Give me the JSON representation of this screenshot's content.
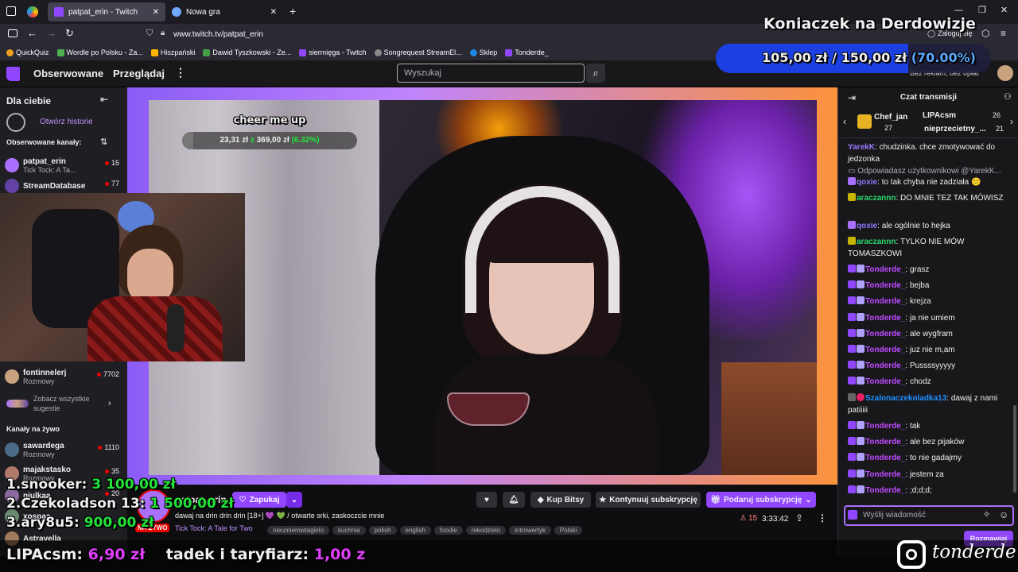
{
  "browser": {
    "tabs": [
      {
        "title": "patpat_erin - Twitch"
      },
      {
        "title": "Nowa gra"
      }
    ],
    "url": "www.twitch.tv/patpat_erin",
    "login_label": "Zaloguj się",
    "bookmarks": [
      "QuickQuiz",
      "Wordle po Polsku - Za...",
      "Hiszpański",
      "Dawid Tyszkowski - Ze...",
      "siermięga - Twitch",
      "Songrequest StreamEl...",
      "Sklep",
      "Tonderde_"
    ]
  },
  "twitch": {
    "nav": {
      "following": "Obserwowane",
      "browse": "Przeglądaj",
      "search_placeholder": "Wyszukaj",
      "no_ads": "Bez reklam, bez opłat"
    },
    "sidebar": {
      "for_you": "Dla ciebie",
      "open_stories": "Otwórz historie",
      "followed_header": "Obserwowane kanały:",
      "followed": [
        {
          "name": "patpat_erin",
          "sub": "Tick Tock: A Ta...",
          "viewers": "15",
          "color": "#a970ff"
        },
        {
          "name": "StreamDatabase",
          "sub": "",
          "viewers": "77",
          "color": "#6441a5"
        },
        {
          "name": "fontinnelerj",
          "sub": "Rozmowy",
          "viewers": "7702",
          "color": "#c9a27e"
        }
      ],
      "see_all": "Zobacz wszystkie sugestie",
      "live_header": "Kanały na żywo",
      "live": [
        {
          "name": "sawardega",
          "sub": "Rozmowy",
          "viewers": "1110",
          "color": "#4a6b8a"
        },
        {
          "name": "majakstasko",
          "sub": "Rozmowy",
          "viewers": "35",
          "color": "#b07a6a"
        },
        {
          "name": "niulkaa",
          "sub": "",
          "viewers": "20",
          "color": "#8a6aa0"
        },
        {
          "name": "xospaa",
          "sub": "",
          "viewers": "",
          "color": "#6a8a70"
        },
        {
          "name": "Astravella",
          "sub": "",
          "viewers": "",
          "color": "#a07a5a"
        }
      ]
    },
    "stream": {
      "channel": "patpat_erin",
      "title": "dawaj na drin drin drin [18+] 💜 💚 / otwarte srki, zaskoczcie mnie",
      "category": "Tick Tock: A Tale for Two",
      "live_badge": "NA ŻYWO",
      "tags": [
        "nieumiemwtagielo",
        "kuchnia",
        "polish",
        "english",
        "foodie",
        "rekodzielo",
        "introwertyk",
        "Polski"
      ],
      "viewers": "15",
      "uptime": "3:33:42",
      "follow_label": "Zapukaj",
      "buttons": {
        "bits": "Kup Bitsy",
        "continue_sub": "Kontynuuj subskrypcję",
        "gift_sub": "Podaruj subskrypcję"
      }
    },
    "chat": {
      "header": "Czat transmisji",
      "leaderboard": [
        {
          "name": "Chef_jan",
          "count": "27"
        },
        {
          "name": "LIPAcsm",
          "count": "26"
        },
        {
          "name": "nieprzecietny_...",
          "count": "21"
        }
      ],
      "messages": [
        {
          "user": "YarekK",
          "text": "chudzinka. chce zmotywować do jedzonka",
          "color": "#9b7bff"
        },
        {
          "user": "",
          "text": "Odpowiadasz użytkownikowi @YarekK...",
          "color": "#adadb8"
        },
        {
          "user": "qoxie",
          "text": "to tak chyba nie zadziała 😕",
          "color": "#8a7bff"
        },
        {
          "user": "araczannn",
          "text": "DO MNIE TEZ TAK MÓWISZ",
          "color": "#2bd96b"
        },
        {
          "user": "qoxie",
          "text": "ale ogólnie to hejka",
          "color": "#8a7bff"
        },
        {
          "user": "araczannn",
          "text": "TYLKO NIE MÓW TOMASZKOWI",
          "color": "#2bd96b"
        },
        {
          "user": "Tonderde_",
          "text": "grasz",
          "color": "#c04bff"
        },
        {
          "user": "Tonderde_",
          "text": "bejba",
          "color": "#c04bff"
        },
        {
          "user": "Tonderde_",
          "text": "krejza",
          "color": "#c04bff"
        },
        {
          "user": "Tonderde_",
          "text": "ja nie umiem",
          "color": "#c04bff"
        },
        {
          "user": "Tonderde_",
          "text": "ale wygfram",
          "color": "#c04bff"
        },
        {
          "user": "Tonderde_",
          "text": "juz nie m,am",
          "color": "#c04bff"
        },
        {
          "user": "Tonderde_",
          "text": "Pussssyyyyy",
          "color": "#c04bff"
        },
        {
          "user": "Tonderde_",
          "text": "chodz",
          "color": "#c04bff"
        },
        {
          "user": "Szalonaczekoladka13",
          "text": "dawaj z nami patiiiii",
          "color": "#1e90ff"
        },
        {
          "user": "Tonderde_",
          "text": "tak",
          "color": "#c04bff"
        },
        {
          "user": "Tonderde_",
          "text": "ale bez pijaków",
          "color": "#c04bff"
        },
        {
          "user": "Tonderde_",
          "text": "to nie gadajmy",
          "color": "#c04bff"
        },
        {
          "user": "Tonderde_",
          "text": "jestem za",
          "color": "#c04bff"
        },
        {
          "user": "Tonderde_",
          "text": ";d;d;d;",
          "color": "#c04bff"
        }
      ],
      "input_placeholder": "Wyślij wiadomość",
      "send_label": "Rozmawiaj"
    }
  },
  "overlays": {
    "goal_title": "Koniaczek na Derdowizje",
    "goal_current": "105,00 zł",
    "goal_sep": "/",
    "goal_target": "150,00 zł",
    "goal_pct": "(70.00%)",
    "goal_progress": 0.7,
    "cheer_title": "cheer me up",
    "cheer_current": "23,31 zł",
    "cheer_sep": "z",
    "cheer_target": "369,00 zł",
    "cheer_pct": "(6.32%)",
    "cheer_progress": 0.0632,
    "leaders": [
      {
        "rank": "1.",
        "name": "snooker:",
        "amount": "3 100,00 zł"
      },
      {
        "rank": "2.",
        "name": "Czekoladson 13:",
        "amount": "1 500,00 zł"
      },
      {
        "rank": "3.",
        "name": "ary8u5:",
        "amount": "900,00 zł"
      }
    ],
    "ticker": [
      {
        "name": "LIPAcsm:",
        "amount": "6,90 zł"
      },
      {
        "name": "tadek i taryfiarz:",
        "amount": "1,00 z"
      }
    ],
    "instagram_handle": "tonderde"
  },
  "colors": {
    "twitch_purple": "#9146ff",
    "green": "#22e33a",
    "magenta": "#e040fb",
    "goal_blue": "#1b3fe0"
  }
}
